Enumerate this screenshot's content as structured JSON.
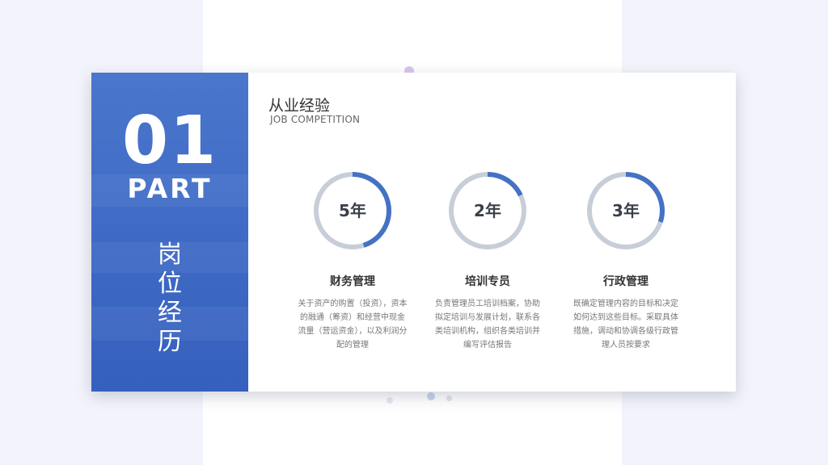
{
  "side": {
    "number": "01",
    "part": "PART",
    "title_chars": [
      "岗",
      "位",
      "经",
      "历"
    ]
  },
  "header": {
    "title": "从业经验",
    "subtitle": "JOB COMPETITION"
  },
  "items": [
    {
      "value": "5年",
      "progress": 0.45,
      "title": "财务管理",
      "desc": "关于资产的购置（投资），资本的融通（筹资）和经营中现金流量（营运资金），以及利润分配的管理"
    },
    {
      "value": "2年",
      "progress": 0.18,
      "title": "培训专员",
      "desc": "负责管理员工培训档案，协助拟定培训与发展计划，联系各类培训机构，组织各类培训并编写评估报告"
    },
    {
      "value": "3年",
      "progress": 0.3,
      "title": "行政管理",
      "desc": "既确定管理内容的目标和决定如何达到这些目标。采取具体措施，调动和协调各级行政管理人员按要求"
    }
  ],
  "colors": {
    "accent": "#4472c4",
    "ring_track": "#c8ced8",
    "side_panel": "#4470c8"
  }
}
